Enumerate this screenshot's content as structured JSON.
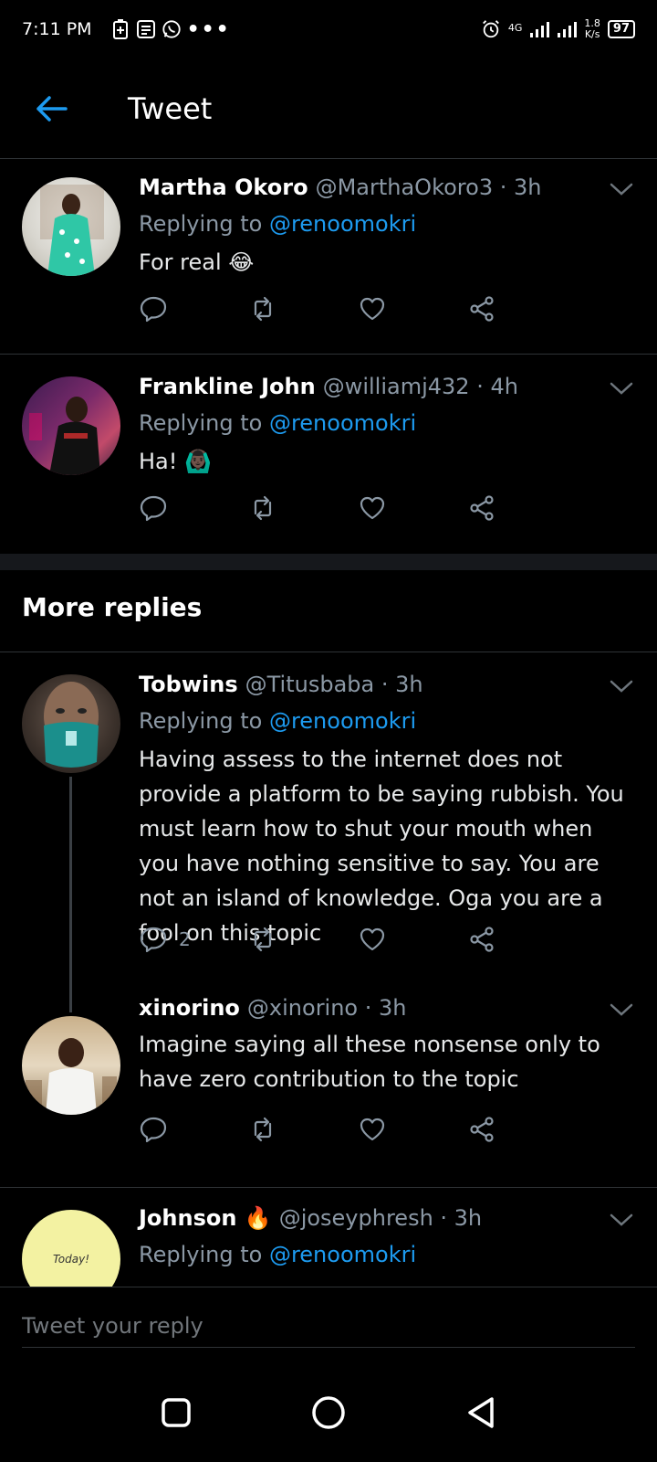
{
  "status_bar": {
    "time": "7:11 PM",
    "network": "4G",
    "speed_value": "1.8",
    "speed_unit": "K/s",
    "battery": "97"
  },
  "header": {
    "title": "Tweet"
  },
  "tweets": [
    {
      "name": "Martha Okoro",
      "handle": "@MarthaOkoro3 · 3h",
      "replying_prefix": "Replying to",
      "mention": "@renoomokri",
      "text": "For real 😂"
    },
    {
      "name": "Frankline John",
      "handle": "@williamj432 · 4h",
      "replying_prefix": "Replying to",
      "mention": "@renoomokri",
      "text": "Ha! 🙆🏿‍♂️"
    }
  ],
  "more_replies": {
    "title": "More replies",
    "tweets": [
      {
        "name": "Tobwins",
        "handle": "@Titusbaba · 3h",
        "replying_prefix": "Replying to",
        "mention": "@renoomokri",
        "text": "Having assess to the internet does not provide a platform to be saying rubbish. You must learn how to shut your mouth when you have nothing sensitive to say. You are not an island of knowledge. Oga you are a fool on this topic",
        "reply_count": "2"
      },
      {
        "name": "xinorino",
        "handle": "@xinorino · 3h",
        "text": "Imagine saying all these nonsense only to have zero contribution to the topic"
      },
      {
        "name": "Johnson 🔥",
        "handle": "@joseyphresh · 3h",
        "replying_prefix": "Replying to",
        "mention": "@renoomokri",
        "avatar_text": "Today!"
      }
    ]
  },
  "reply_box": {
    "placeholder": "Tweet your reply"
  },
  "colors": {
    "accent": "#1d9bf0",
    "background": "#000000",
    "secondary_text": "#8b98a5"
  }
}
